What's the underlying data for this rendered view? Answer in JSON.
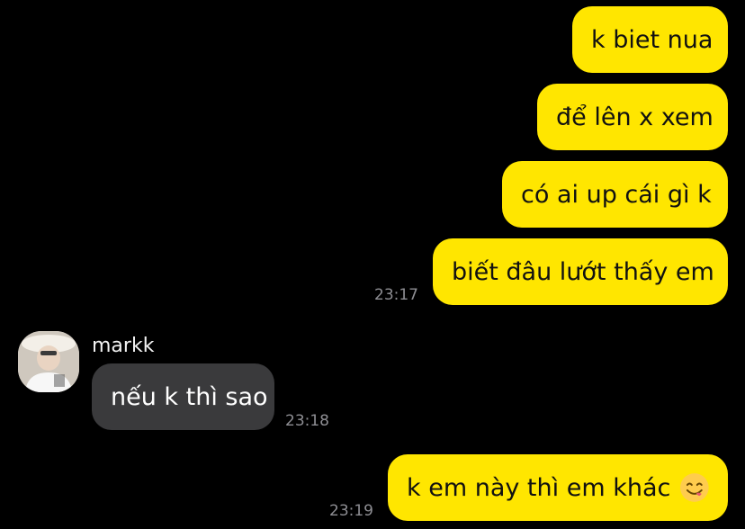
{
  "colors": {
    "background": "#000000",
    "outgoing_bubble": "#ffe600",
    "incoming_bubble": "#3a3a3c",
    "timestamp": "#8e8e93"
  },
  "messages": [
    {
      "direction": "out",
      "text": "k biet nua"
    },
    {
      "direction": "out",
      "text": "để lên x xem"
    },
    {
      "direction": "out",
      "text": "có ai up cái gì k"
    },
    {
      "direction": "out",
      "text": "biết đâu lướt thấy em",
      "time": "23:17"
    },
    {
      "direction": "in",
      "sender": "markk",
      "text": "nếu k thì sao",
      "time": "23:18"
    },
    {
      "direction": "out",
      "text": "k em này thì em khác",
      "emoji": "face-savoring-food-icon",
      "time": "23:19"
    }
  ]
}
